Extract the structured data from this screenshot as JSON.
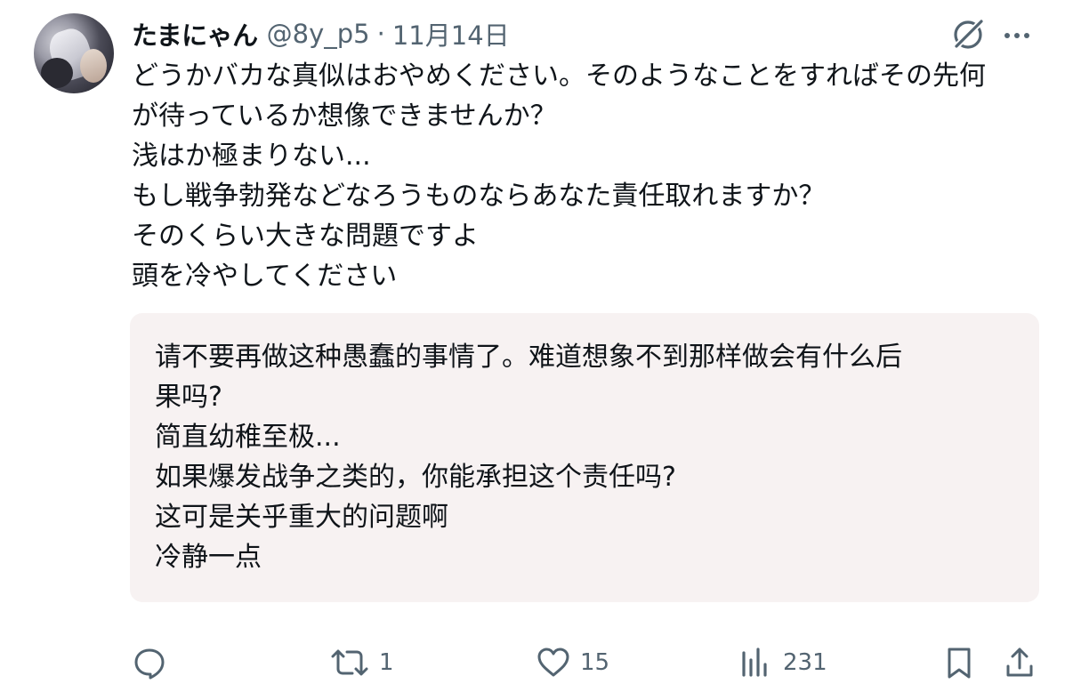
{
  "tweet": {
    "author": {
      "display_name": "たまにゃん",
      "handle": "@8y_p5"
    },
    "separator": "·",
    "date": "11月14日",
    "text_lines": [
      "どうかバカな真似はおやめください。そのようなことをすればその先何",
      "が待っているか想像できませんか？",
      "浅はか極まりない...",
      "もし戦争勃発などなろうものならあなた責任取れますか？",
      "そのくらい大きな問題ですよ",
      "頭を冷やしてください"
    ],
    "translation_lines": [
      "请不要再做这种愚蠢的事情了。难道想象不到那样做会有什么后",
      "果吗?",
      "简直幼稚至极...",
      "如果爆发战争之类的，你能承担这个责任吗?",
      "这可是关乎重大的问题啊",
      "冷静一点"
    ]
  },
  "header_icons": {
    "grok": "grok-icon",
    "more": "more-dots-icon"
  },
  "actions": {
    "reply": {
      "icon": "reply-icon",
      "count": ""
    },
    "retweet": {
      "icon": "retweet-icon",
      "count": "1"
    },
    "like": {
      "icon": "heart-icon",
      "count": "15"
    },
    "views": {
      "icon": "views-chart-icon",
      "count": "231"
    },
    "bookmark": {
      "icon": "bookmark-icon"
    },
    "share": {
      "icon": "share-icon"
    }
  },
  "colors": {
    "text": "#0f1419",
    "secondary": "#536471",
    "translation_bg": "#f7f2f2"
  }
}
